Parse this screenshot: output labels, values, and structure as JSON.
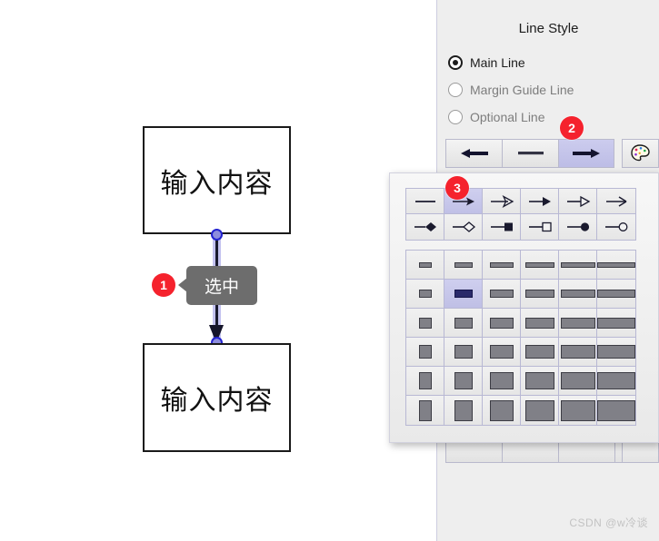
{
  "canvas": {
    "nodes": [
      {
        "id": "node-top",
        "label": "输入内容"
      },
      {
        "id": "node-bottom",
        "label": "输入内容"
      }
    ],
    "connector": {
      "selected": true,
      "handle_color": "#2323d0",
      "halo_color": "#b9b7ec",
      "line_color": "#1a1a2e"
    },
    "callout": {
      "text": "选中"
    }
  },
  "badges": [
    {
      "number": "1"
    },
    {
      "number": "2"
    },
    {
      "number": "3"
    }
  ],
  "panel": {
    "title": "Line Style",
    "radios": [
      {
        "label": "Main Line",
        "checked": true,
        "enabled": true
      },
      {
        "label": "Margin Guide Line",
        "checked": false,
        "enabled": false
      },
      {
        "label": "Optional Line",
        "checked": false,
        "enabled": false
      }
    ],
    "toolbar": [
      {
        "name": "start-arrow-button",
        "icon": "arrow-left-icon",
        "selected": false
      },
      {
        "name": "line-style-button",
        "icon": "horizontal-line-icon",
        "selected": false
      },
      {
        "name": "end-arrow-button",
        "icon": "arrow-right-icon",
        "selected": true
      }
    ],
    "palette_button": {
      "name": "color-palette-button",
      "icon": "palette-icon"
    }
  },
  "popup": {
    "arrow_styles": [
      {
        "icon": "plain-line-icon",
        "selected": false
      },
      {
        "icon": "solid-arrow-icon",
        "selected": true
      },
      {
        "icon": "open-arrow-icon",
        "selected": false
      },
      {
        "icon": "filled-triangle-arrow-icon",
        "selected": false
      },
      {
        "icon": "hollow-triangle-arrow-icon",
        "selected": false
      },
      {
        "icon": "thin-arrow-icon",
        "selected": false
      },
      {
        "icon": "filled-diamond-icon",
        "selected": false
      },
      {
        "icon": "hollow-diamond-icon",
        "selected": false
      },
      {
        "icon": "filled-square-icon",
        "selected": false
      },
      {
        "icon": "hollow-square-icon",
        "selected": false
      },
      {
        "icon": "filled-circle-icon",
        "selected": false
      },
      {
        "icon": "hollow-circle-icon",
        "selected": false
      }
    ],
    "width_grid": {
      "rows": 6,
      "cols": 6,
      "swatch_widths": [
        14,
        20,
        26,
        32,
        38,
        44
      ],
      "swatch_heights": [
        6,
        9,
        12,
        15,
        19,
        23
      ],
      "selected_row": 2,
      "selected_col": 2,
      "swatch_color": "#808087",
      "selected_color": "#2a2a6a"
    }
  },
  "bottom_row": {
    "buttons": [
      {
        "name": "bottom-button-1"
      },
      {
        "name": "bottom-button-2"
      },
      {
        "name": "bottom-button-3"
      },
      {
        "name": "bottom-button-4"
      }
    ],
    "extra": {
      "name": "bottom-extra-button"
    }
  },
  "watermark": {
    "text": "CSDN @w冷谈"
  }
}
